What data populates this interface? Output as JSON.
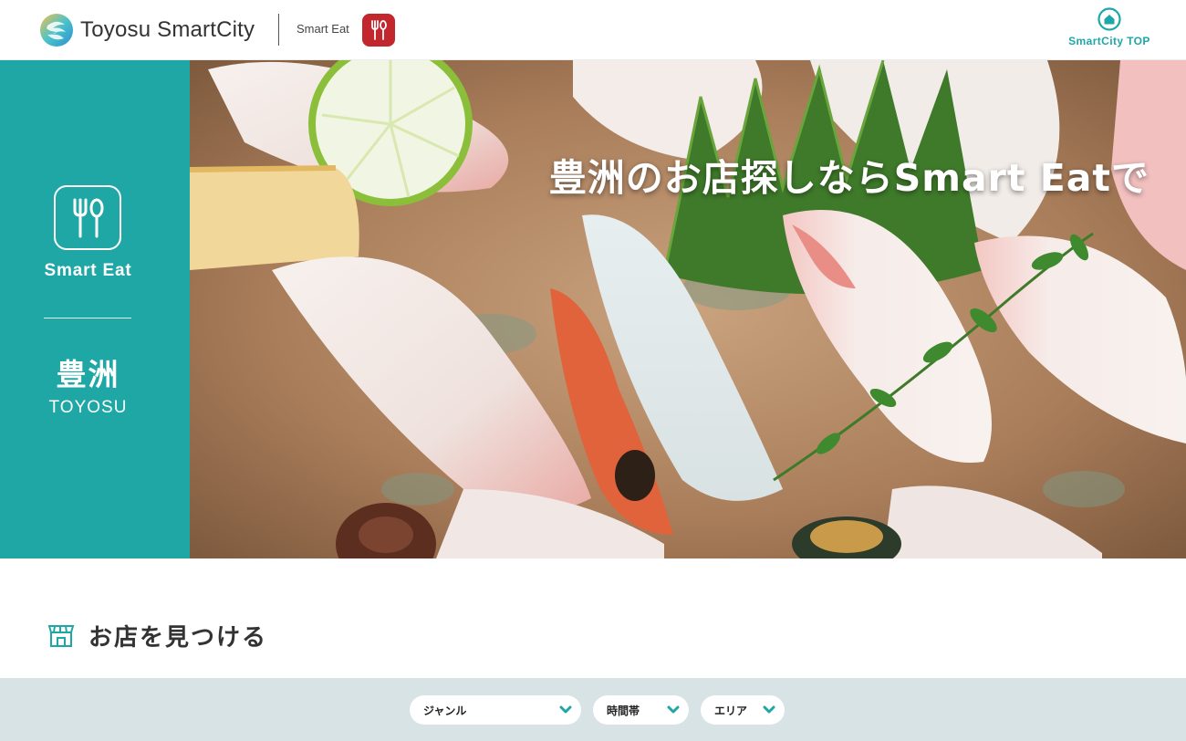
{
  "header": {
    "brand_name": "Toyosu SmartCity",
    "sub_brand": "Smart Eat",
    "top_link_label": "SmartCity TOP"
  },
  "hero": {
    "side_label": "Smart Eat",
    "area_jp": "豊洲",
    "area_en": "TOYOSU",
    "headline": "豊洲のお店探しならSmart Eatで"
  },
  "section": {
    "title": "お店を見つける"
  },
  "filters": [
    {
      "label": "ジャンル"
    },
    {
      "label": "時間帯"
    },
    {
      "label": "エリア"
    }
  ],
  "colors": {
    "accent": "#1fa7a6",
    "badge_red": "#c1272d",
    "filter_bar": "#d8e3e6"
  },
  "icons": {
    "brand_logo": "swirl-logo-icon",
    "eat_badge": "fork-spoon-icon",
    "top_link": "home-icon",
    "section": "shop-icon",
    "filter_chevron": "chevron-down-icon"
  }
}
